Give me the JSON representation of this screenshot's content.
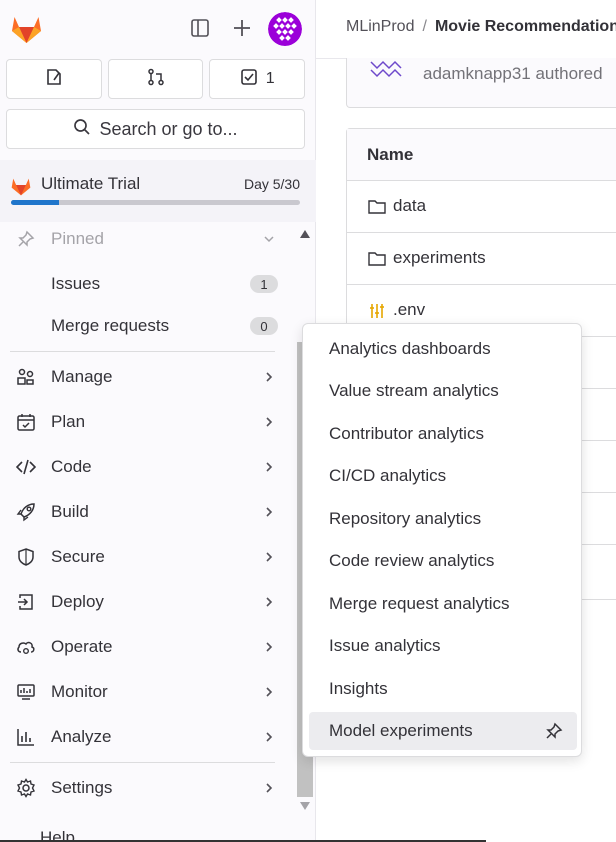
{
  "sidebar": {
    "counters": [
      {
        "icon": "issues-icon",
        "value": ""
      },
      {
        "icon": "merge-request-icon",
        "value": ""
      },
      {
        "icon": "todo-icon",
        "value": "1"
      }
    ],
    "search_label": "Search or go to...",
    "trial": {
      "title": "Ultimate Trial",
      "day": "Day 5/30",
      "progress": 0.1667
    },
    "pinned_label": "Pinned",
    "pinned_items": [
      {
        "label": "Issues",
        "count": "1"
      },
      {
        "label": "Merge requests",
        "count": "0"
      }
    ],
    "nav_items": [
      {
        "label": "Manage",
        "icon": "users-icon"
      },
      {
        "label": "Plan",
        "icon": "calendar-icon"
      },
      {
        "label": "Code",
        "icon": "code-icon"
      },
      {
        "label": "Build",
        "icon": "rocket-icon"
      },
      {
        "label": "Secure",
        "icon": "shield-icon"
      },
      {
        "label": "Deploy",
        "icon": "deploy-icon"
      },
      {
        "label": "Operate",
        "icon": "cloud-gear-icon"
      },
      {
        "label": "Monitor",
        "icon": "monitor-icon"
      },
      {
        "label": "Analyze",
        "icon": "chart-icon"
      }
    ],
    "settings_label": "Settings",
    "help_label": "Help"
  },
  "breadcrumb": {
    "group": "MLinProd",
    "separator": "/",
    "project": "Movie Recommendations"
  },
  "commit": {
    "author_text": "adamknapp31 authored"
  },
  "table": {
    "header": "Name",
    "rows": [
      {
        "name": "data",
        "type": "folder"
      },
      {
        "name": "experiments",
        "type": "folder"
      },
      {
        "name": ".env",
        "type": "file"
      },
      {
        "name": "",
        "type": "file"
      },
      {
        "name": "",
        "type": "file"
      },
      {
        "name": "",
        "type": "file"
      },
      {
        "name": "",
        "type": "file"
      },
      {
        "name": "",
        "type": "file"
      }
    ]
  },
  "flyout": {
    "items": [
      "Analytics dashboards",
      "Value stream analytics",
      "Contributor analytics",
      "CI/CD analytics",
      "Repository analytics",
      "Code review analytics",
      "Merge request analytics",
      "Issue analytics",
      "Insights",
      "Model experiments"
    ],
    "hovered_index": 9
  },
  "colors": {
    "accent": "#1f75cb",
    "tanuki_orange": "#e24329",
    "avatar_purple": "#9b00d9"
  }
}
